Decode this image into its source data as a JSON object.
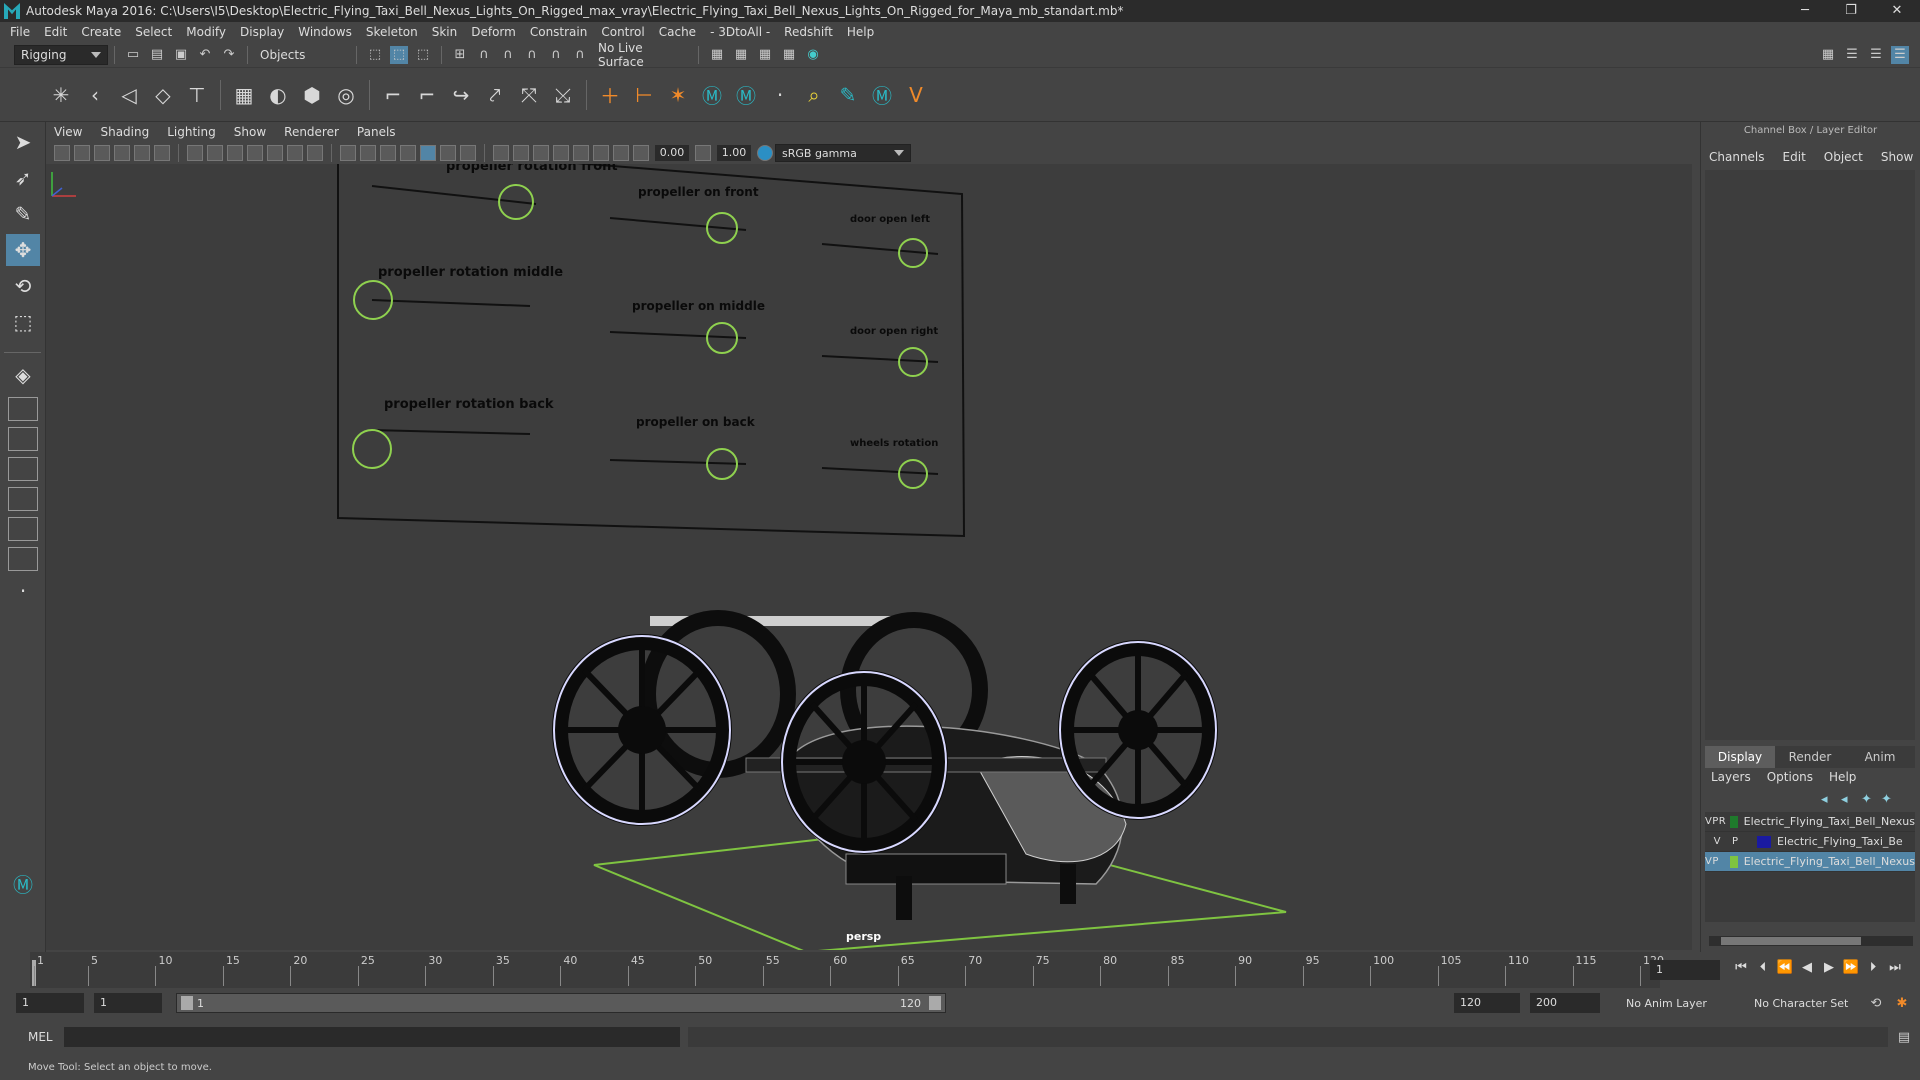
{
  "window": {
    "title": "Autodesk Maya 2016: C:\\Users\\I5\\Desktop\\Electric_Flying_Taxi_Bell_Nexus_Lights_On_Rigged_max_vray\\Electric_Flying_Taxi_Bell_Nexus_Lights_On_Rigged_for_Maya_mb_standart.mb*",
    "minimize": "─",
    "maximize": "❐",
    "close": "✕"
  },
  "menu": [
    "File",
    "Edit",
    "Create",
    "Select",
    "Modify",
    "Display",
    "Windows",
    "Skeleton",
    "Skin",
    "Deform",
    "Constrain",
    "Control",
    "Cache",
    "- 3DtoAll -",
    "Redshift",
    "Help"
  ],
  "statusline": {
    "menuset": "Rigging",
    "selection_mode": "Objects",
    "live_surface": "No Live Surface"
  },
  "panel_menu": [
    "View",
    "Shading",
    "Lighting",
    "Show",
    "Renderer",
    "Panels"
  ],
  "viewport_toolbar": {
    "exposure": "0.00",
    "gamma": "1.00",
    "color_space": "sRGB gamma"
  },
  "viewport": {
    "camera": "persp",
    "control_labels": [
      "propeller rotation front",
      "propeller on front",
      "door open left",
      "propeller rotation middle",
      "propeller on middle",
      "door open right",
      "propeller rotation back",
      "propeller on back",
      "wheels rotation"
    ],
    "colors": {
      "controller": "#8fd14f",
      "grid": "#7fc441"
    }
  },
  "channelbox": {
    "title": "Channel Box / Layer Editor",
    "tabs": [
      "Channels",
      "Edit",
      "Object",
      "Show"
    ]
  },
  "layer_editor": {
    "tabs": [
      "Display",
      "Render",
      "Anim"
    ],
    "menu": [
      "Layers",
      "Options",
      "Help"
    ],
    "layers": [
      {
        "v": "V",
        "p": "P",
        "r": "R",
        "color": "#1f7a2c",
        "name": "Electric_Flying_Taxi_Bell_Nexus",
        "selected": false
      },
      {
        "v": "V",
        "p": "P",
        "r": "",
        "color": "#1a1aa0",
        "name": "Electric_Flying_Taxi_Be",
        "selected": false
      },
      {
        "v": "V",
        "p": "P",
        "r": "",
        "color": "#7fc441",
        "name": "Electric_Flying_Taxi_Bell_Nexus",
        "selected": true
      }
    ]
  },
  "timeline": {
    "tick_labels": [
      "1",
      "5",
      "10",
      "15",
      "20",
      "25",
      "30",
      "35",
      "40",
      "45",
      "50",
      "55",
      "60",
      "65",
      "70",
      "75",
      "80",
      "85",
      "90",
      "95",
      "100",
      "105",
      "110",
      "115",
      "120"
    ],
    "current_frame": "1"
  },
  "range": {
    "start": "1",
    "inner_start": "1",
    "range_low": "1",
    "range_high": "120",
    "end": "120",
    "max_end": "200",
    "anim_layer": "No Anim Layer",
    "character_set": "No Character Set"
  },
  "command": {
    "label": "MEL"
  },
  "help": {
    "text": "Move Tool: Select an object to move."
  }
}
